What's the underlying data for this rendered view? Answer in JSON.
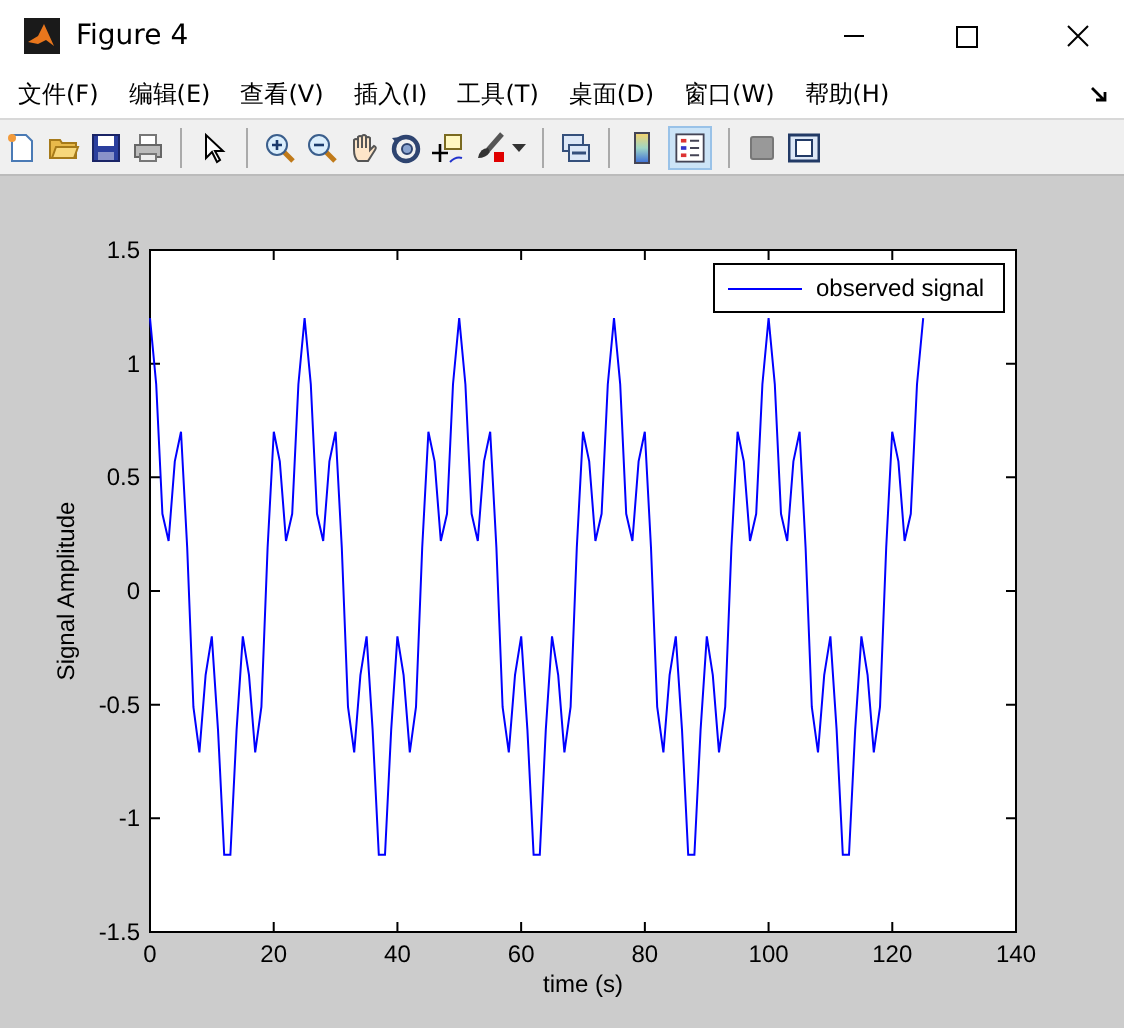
{
  "window": {
    "title": "Figure 4"
  },
  "menu": [
    {
      "label": "文件(F)"
    },
    {
      "label": "编辑(E)"
    },
    {
      "label": "查看(V)"
    },
    {
      "label": "插入(I)"
    },
    {
      "label": "工具(T)"
    },
    {
      "label": "桌面(D)"
    },
    {
      "label": "窗口(W)"
    },
    {
      "label": "帮助(H)"
    }
  ],
  "toolbar": {
    "legend_button": {
      "selected": true
    }
  },
  "figure": {
    "chart_data": {
      "type": "line",
      "xlabel": "time (s)",
      "ylabel": "Signal Amplitude",
      "xlim": [
        0,
        140
      ],
      "ylim": [
        -1.5,
        1.5
      ],
      "xticks": [
        0,
        20,
        40,
        60,
        80,
        100,
        120,
        140
      ],
      "yticks": [
        -1.5,
        -1,
        -0.5,
        0,
        0.5,
        1,
        1.5
      ],
      "x": [
        0,
        1,
        2,
        3,
        4,
        5,
        6,
        7,
        8,
        9,
        10,
        11,
        12,
        13,
        14,
        15,
        16,
        17,
        18,
        19,
        20,
        21,
        22,
        23,
        24,
        25,
        26,
        27,
        28,
        29,
        30,
        31,
        32,
        33,
        34,
        35,
        36,
        37,
        38,
        39,
        40,
        41,
        42,
        43,
        44,
        45,
        46,
        47,
        48,
        49,
        50,
        51,
        52,
        53,
        54,
        55,
        56,
        57,
        58,
        59,
        60,
        61,
        62,
        63,
        64,
        65,
        66,
        67,
        68,
        69,
        70,
        71,
        72,
        73,
        74,
        75,
        76,
        77,
        78,
        79,
        80,
        81,
        82,
        83,
        84,
        85,
        86,
        87,
        88,
        89,
        90,
        91,
        92,
        93,
        94,
        95,
        96,
        97,
        98,
        99,
        100,
        101,
        102,
        103,
        104,
        105,
        106,
        107,
        108,
        109,
        110,
        111,
        112,
        113,
        114,
        115,
        116,
        117,
        118,
        119,
        120,
        121,
        122,
        123,
        124,
        125
      ],
      "series": [
        {
          "name": "observed signal",
          "color": "#0000ff",
          "values": [
            1.2,
            0.91,
            0.34,
            0.22,
            0.57,
            0.7,
            0.19,
            -0.51,
            -0.71,
            -0.37,
            -0.2,
            -0.61,
            -1.16,
            -1.16,
            -0.61,
            -0.2,
            -0.37,
            -0.71,
            -0.51,
            0.19,
            0.7,
            0.57,
            0.22,
            0.34,
            0.91,
            1.2,
            0.91,
            0.34,
            0.22,
            0.57,
            0.7,
            0.19,
            -0.51,
            -0.71,
            -0.37,
            -0.2,
            -0.61,
            -1.16,
            -1.16,
            -0.61,
            -0.2,
            -0.37,
            -0.71,
            -0.51,
            0.19,
            0.7,
            0.57,
            0.22,
            0.34,
            0.91,
            1.2,
            0.91,
            0.34,
            0.22,
            0.57,
            0.7,
            0.19,
            -0.51,
            -0.71,
            -0.37,
            -0.2,
            -0.61,
            -1.16,
            -1.16,
            -0.61,
            -0.2,
            -0.37,
            -0.71,
            -0.51,
            0.19,
            0.7,
            0.57,
            0.22,
            0.34,
            0.91,
            1.2,
            0.91,
            0.34,
            0.22,
            0.57,
            0.7,
            0.19,
            -0.51,
            -0.71,
            -0.37,
            -0.2,
            -0.61,
            -1.16,
            -1.16,
            -0.61,
            -0.2,
            -0.37,
            -0.71,
            -0.51,
            0.19,
            0.7,
            0.57,
            0.22,
            0.34,
            0.91,
            1.2,
            0.91,
            0.34,
            0.22,
            0.57,
            0.7,
            0.19,
            -0.51,
            -0.71,
            -0.37,
            -0.2,
            -0.61,
            -1.16,
            -1.16,
            -0.61,
            -0.2,
            -0.37,
            -0.71,
            -0.51,
            0.19,
            0.7,
            0.57,
            0.22,
            0.34,
            0.91,
            1.2
          ]
        }
      ]
    }
  }
}
